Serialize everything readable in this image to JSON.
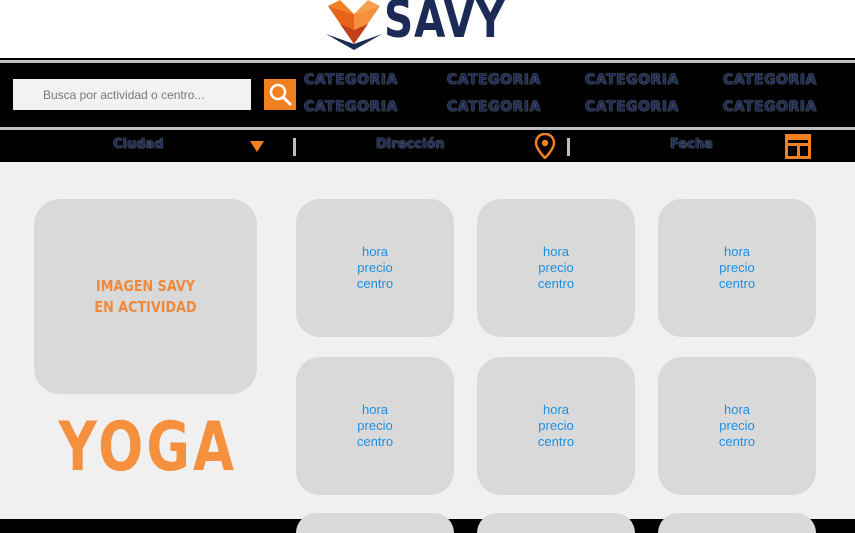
{
  "header": {
    "brand": "SAVY"
  },
  "search": {
    "placeholder": "Busca por actividad o centro..."
  },
  "categories": [
    "CATEGORIA",
    "CATEGORIA",
    "CATEGORIA",
    "CATEGORIA",
    "CATEGORIA",
    "CATEGORIA",
    "CATEGORIA",
    "CATEGORIA"
  ],
  "filters": {
    "city": "Ciudad",
    "address": "Dirección",
    "date": "Fecha"
  },
  "featured": {
    "image_label_line1": "IMAGEN SAVY",
    "image_label_line2": "EN ACTIVIDAD",
    "activity": "YOGA"
  },
  "tiles": [
    {
      "hora": "hora",
      "precio": "precio",
      "centro": "centro"
    },
    {
      "hora": "hora",
      "precio": "precio",
      "centro": "centro"
    },
    {
      "hora": "hora",
      "precio": "precio",
      "centro": "centro"
    },
    {
      "hora": "hora",
      "precio": "precio",
      "centro": "centro"
    },
    {
      "hora": "hora",
      "precio": "precio",
      "centro": "centro"
    },
    {
      "hora": "hora",
      "precio": "precio",
      "centro": "centro"
    }
  ],
  "colors": {
    "accent": "#f08020",
    "navy": "#1b2a56",
    "tile": "#d9d9d9",
    "link": "#1f8fe0"
  },
  "icons": [
    "fox-logo-icon",
    "search-icon",
    "dropdown-arrow-icon",
    "location-pin-icon",
    "calendar-icon"
  ]
}
